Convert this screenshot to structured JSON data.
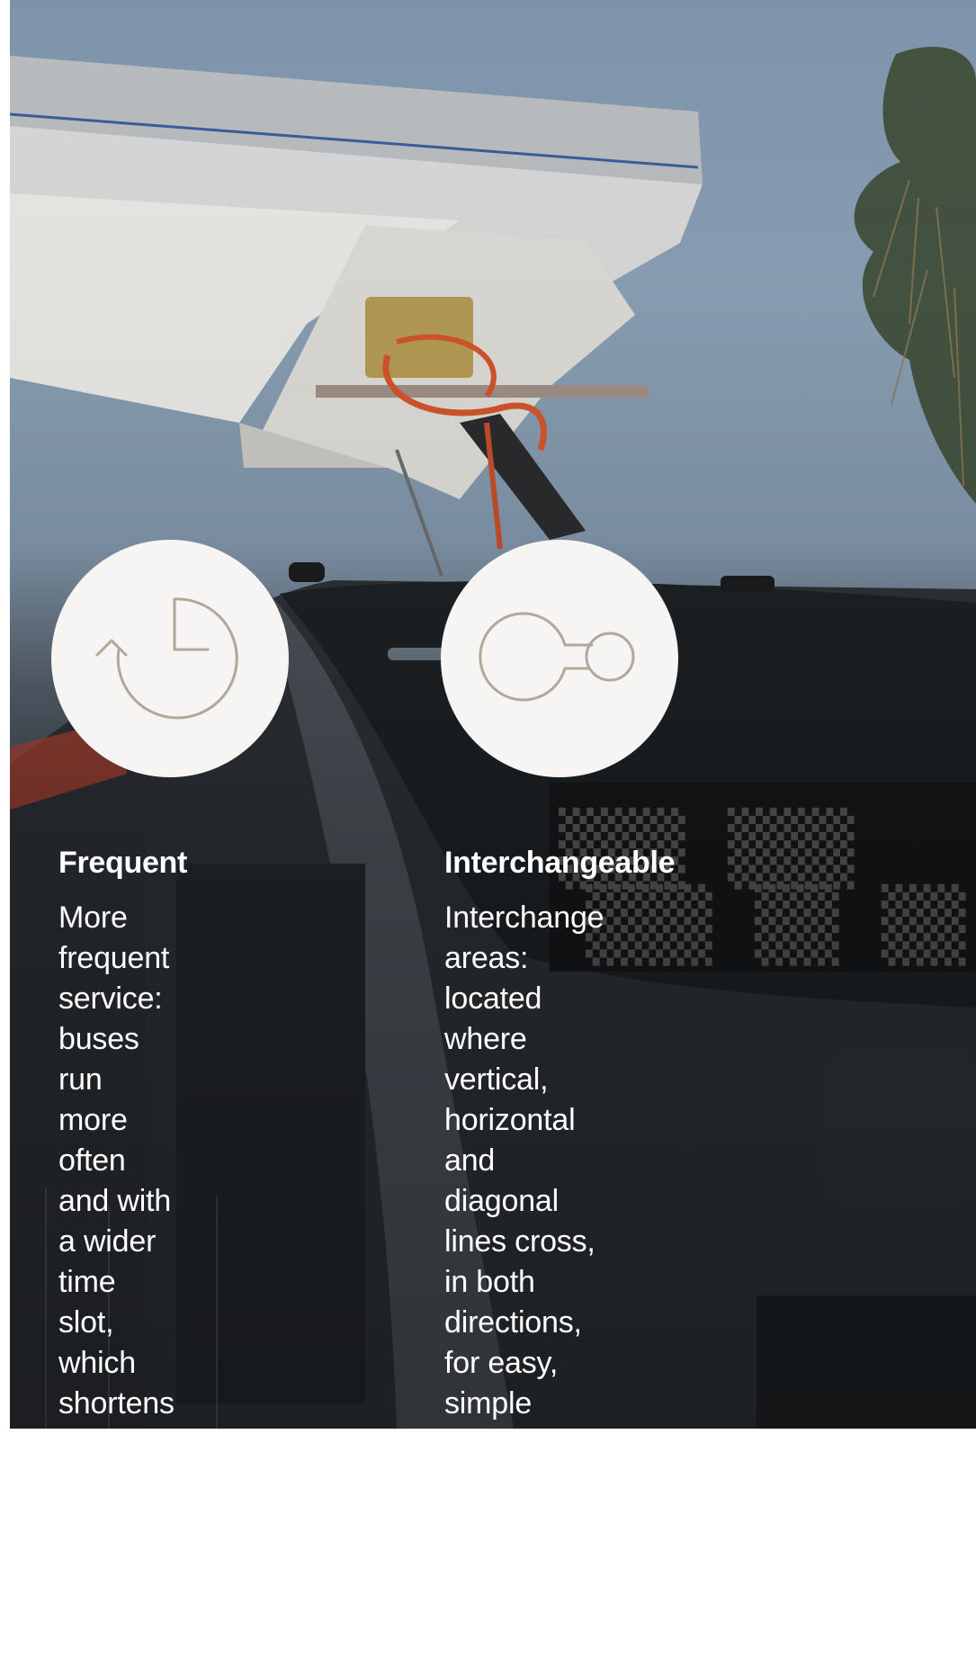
{
  "features": [
    {
      "icon": "clock-refresh-icon",
      "title": "Frequent",
      "body": "More frequent\nservice: buses run\nmore often and with\na wider time slot,\nwhich shortens\nwaiting times at\nstops."
    },
    {
      "icon": "interchange-connection-icon",
      "title": "Interchangeable",
      "body": "Interchange areas:\nlocated where vertical,\nhorizontal and\ndiagonal lines cross,\nin both directions,\nfor easy, simple\nand convenient\nconnection from one\nline to the other."
    }
  ],
  "colors": {
    "icon_stroke": "#b0a898",
    "circle_fill": "#f6f5f3",
    "text": "#ffffff"
  }
}
